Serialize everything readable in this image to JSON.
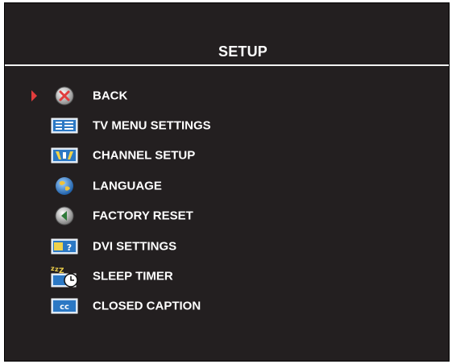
{
  "header": {
    "title": "SETUP"
  },
  "menu": {
    "items": [
      {
        "label": "BACK",
        "icon": "back-icon",
        "selected": true
      },
      {
        "label": "TV MENU SETTINGS",
        "icon": "tv-menu-settings-icon",
        "selected": false
      },
      {
        "label": "CHANNEL SETUP",
        "icon": "channel-setup-icon",
        "selected": false
      },
      {
        "label": "LANGUAGE",
        "icon": "globe-icon",
        "selected": false
      },
      {
        "label": "FACTORY RESET",
        "icon": "factory-reset-icon",
        "selected": false
      },
      {
        "label": "DVI SETTINGS",
        "icon": "dvi-settings-icon",
        "selected": false
      },
      {
        "label": "SLEEP TIMER",
        "icon": "sleep-timer-icon",
        "selected": false
      },
      {
        "label": "CLOSED CAPTION",
        "icon": "closed-caption-icon",
        "selected": false
      }
    ]
  },
  "colors": {
    "background": "#231f20",
    "text": "#ffffff",
    "selection_pointer": "#e13c3c",
    "icon_blue": "#2b78c4",
    "icon_yellow": "#f0d24a"
  }
}
